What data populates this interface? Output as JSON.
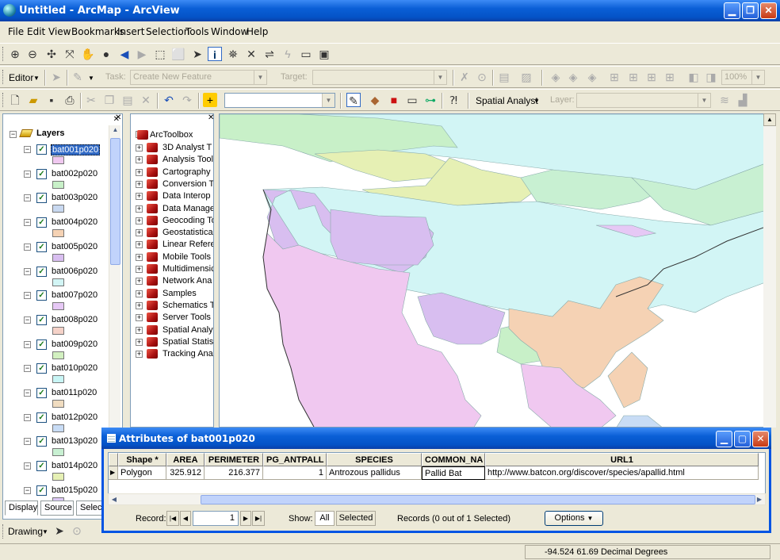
{
  "window": {
    "title": "Untitled - ArcMap - ArcView"
  },
  "menu": [
    "File",
    "Edit",
    "View",
    "Bookmarks",
    "Insert",
    "Selection",
    "Tools",
    "Window",
    "Help"
  ],
  "editor_toolbar": {
    "editor_label": "Editor",
    "task_label": "Task:",
    "task_value": "Create New Feature",
    "target_label": "Target:",
    "zoom_value": "100%"
  },
  "standard_toolbar": {
    "spatial_analyst_label": "Spatial Analyst",
    "layer_label": "Layer:"
  },
  "toc": {
    "root_label": "Layers",
    "layers": [
      {
        "name": "bat001p020",
        "color": "#f0c8f0"
      },
      {
        "name": "bat002p020",
        "color": "#c8f0c8"
      },
      {
        "name": "bat003p020",
        "color": "#c8d8f0"
      },
      {
        "name": "bat004p020",
        "color": "#f5d2b4"
      },
      {
        "name": "bat005p020",
        "color": "#d8bef0"
      },
      {
        "name": "bat006p020",
        "color": "#d2f5f5"
      },
      {
        "name": "bat007p020",
        "color": "#e6c8f5"
      },
      {
        "name": "bat008p020",
        "color": "#f5d2c8"
      },
      {
        "name": "bat009p020",
        "color": "#d2f0c0"
      },
      {
        "name": "bat010p020",
        "color": "#c8f5f5"
      },
      {
        "name": "bat011p020",
        "color": "#f0dcc0"
      },
      {
        "name": "bat012p020",
        "color": "#c8dcf5"
      },
      {
        "name": "bat013p020",
        "color": "#c8f0d2"
      },
      {
        "name": "bat014p020",
        "color": "#e6f0b4"
      },
      {
        "name": "bat015p020",
        "color": "#dcc8f5"
      }
    ],
    "tabs": [
      "Display",
      "Source",
      "Selection"
    ]
  },
  "toolbox": {
    "root_label": "ArcToolbox",
    "items": [
      "3D Analyst T",
      "Analysis Tool",
      "Cartography",
      "Conversion T",
      "Data Interop",
      "Data Manage",
      "Geocoding To",
      "Geostatistica",
      "Linear Refere",
      "Mobile Tools",
      "Multidimensic",
      "Network Ana",
      "Samples",
      "Schematics T",
      "Server Tools",
      "Spatial Analy",
      "Spatial Statis",
      "Tracking Ana"
    ]
  },
  "attributes": {
    "title": "Attributes of bat001p020",
    "columns": [
      "Shape *",
      "AREA",
      "PERIMETER",
      "PG_ANTPALL",
      "SPECIES",
      "COMMON_NA",
      "URL1"
    ],
    "row": {
      "shape": "Polygon",
      "area": "325.912",
      "perimeter": "216.377",
      "pg_antpall": "1",
      "species": "Antrozous pallidus",
      "common_name": "Pallid Bat",
      "url": "http://www.batcon.org/discover/species/apallid.html"
    },
    "record_label": "Record:",
    "record_value": "1",
    "show_label": "Show:",
    "show_all": "All",
    "show_selected": "Selected",
    "records_text": "Records (0 out of 1 Selected)",
    "options_label": "Options"
  },
  "drawing_toolbar": {
    "label": "Drawing"
  },
  "status": {
    "coordinates": "-94.524  61.69 Decimal Degrees"
  },
  "colors": {
    "titlebar": "#0a5fd6",
    "map_pink": "#f0c8f0",
    "map_cyan": "#d2f5f5",
    "map_green": "#c8f0c8",
    "map_orange": "#f5d2b4",
    "map_purple": "#d8bef0"
  }
}
